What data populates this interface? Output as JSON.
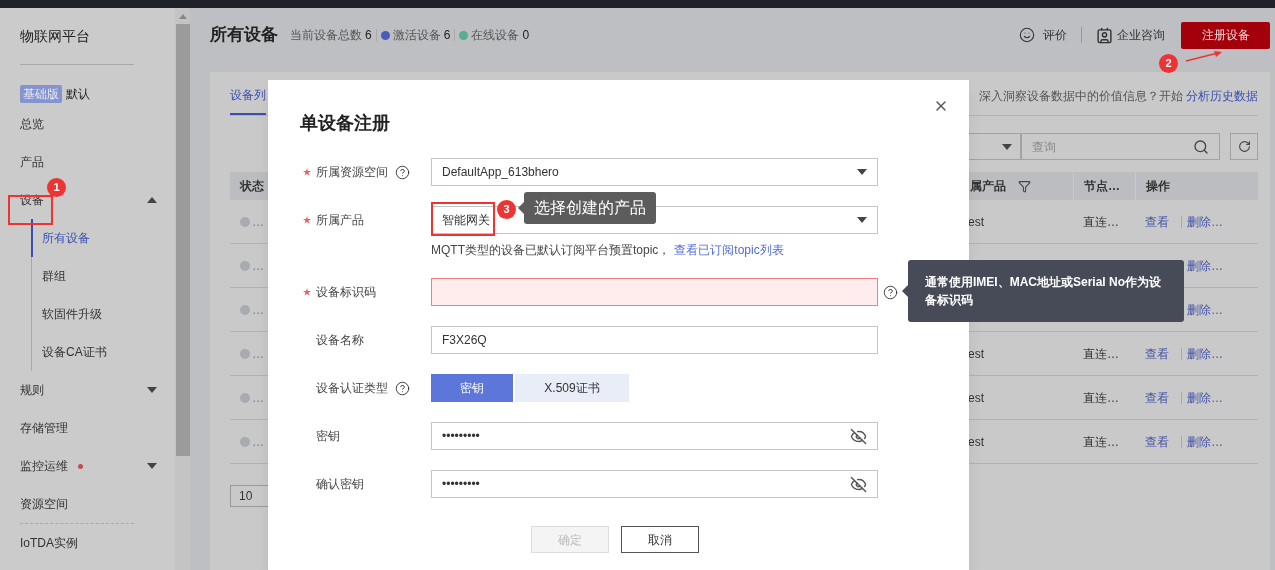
{
  "sidebar": {
    "title": "物联网平台",
    "edition_badge": "基础版",
    "edition_name": "默认",
    "items": [
      {
        "label": "总览",
        "kind": "link",
        "selected": false,
        "alert": false
      },
      {
        "label": "产品",
        "kind": "link",
        "selected": false,
        "alert": false
      },
      {
        "label": "设备",
        "kind": "group",
        "selected": false,
        "alert": false,
        "expanded": true,
        "children": [
          {
            "label": "所有设备",
            "selected": true
          },
          {
            "label": "群组",
            "selected": false
          },
          {
            "label": "软固件升级",
            "selected": false
          },
          {
            "label": "设备CA证书",
            "selected": false
          }
        ]
      },
      {
        "label": "规则",
        "kind": "group",
        "selected": false,
        "alert": false,
        "expanded": false
      },
      {
        "label": "存储管理",
        "kind": "link",
        "selected": false,
        "alert": false
      },
      {
        "label": "监控运维",
        "kind": "group",
        "selected": false,
        "alert": true,
        "expanded": false
      },
      {
        "label": "资源空间",
        "kind": "link",
        "selected": false,
        "alert": false
      },
      {
        "label": "IoTDA实例",
        "kind": "footer",
        "selected": false,
        "alert": false
      }
    ]
  },
  "header": {
    "title": "所有设备",
    "stats": [
      {
        "label": "当前设备总数",
        "value": "6"
      },
      {
        "label": "激活设备",
        "value": "6",
        "color": "#4b5cb8"
      },
      {
        "label": "在线设备",
        "value": "0",
        "color": "#55ae8d"
      }
    ],
    "actions": [
      "评价",
      "企业咨询"
    ],
    "primary_button": "注册设备"
  },
  "card": {
    "tab": "设备列",
    "promo_text": "深入洞察设备数据中的价值信息？开始",
    "promo_link": "分析历史数据",
    "search_placeholder": "查询",
    "columns": [
      "状态",
      "属产品",
      "节点…",
      "操作"
    ],
    "rows": [
      {
        "status": "…",
        "product": "est",
        "node": "直连…",
        "view": "查看",
        "delete": "删除…"
      },
      {
        "status": "…",
        "delete": "删除…"
      },
      {
        "status": "…",
        "delete": "删除…"
      },
      {
        "status": "…",
        "product": "est",
        "node": "直连…",
        "view": "查看",
        "delete": "删除…"
      },
      {
        "status": "…",
        "product": "est",
        "node": "直连…",
        "view": "查看",
        "delete": "删除…"
      },
      {
        "status": "…",
        "product": "est",
        "node": "直连…",
        "view": "查看",
        "delete": "删除…"
      }
    ],
    "page_size": "10"
  },
  "modal": {
    "title": "单设备注册",
    "fields": [
      {
        "label": "所属资源空间",
        "required": true,
        "label_help": true,
        "field_help": false,
        "kind": "select",
        "value": "DefaultApp_613bhero"
      },
      {
        "label": "所属产品",
        "required": true,
        "label_help": false,
        "field_help": false,
        "kind": "select",
        "value": "智能网关",
        "hint": "MQTT类型的设备已默认订阅平台预置topic，",
        "hint_link": "查看已订阅topic列表"
      },
      {
        "label": "设备标识码",
        "required": true,
        "label_help": false,
        "field_help": true,
        "kind": "input",
        "error": true
      },
      {
        "label": "设备名称",
        "required": false,
        "label_help": false,
        "field_help": false,
        "kind": "input",
        "value": "F3X26Q",
        "error": false
      },
      {
        "label": "设备认证类型",
        "required": false,
        "label_help": true,
        "field_help": false,
        "kind": "toggle",
        "options": [
          {
            "label": "密钥",
            "selected": true
          },
          {
            "label": "X.509证书",
            "selected": false
          }
        ]
      },
      {
        "label": "密钥",
        "required": false,
        "label_help": false,
        "field_help": false,
        "kind": "password",
        "value": "•••••••••"
      },
      {
        "label": "确认密钥",
        "required": false,
        "label_help": false,
        "field_help": false,
        "kind": "password",
        "value": "•••••••••"
      }
    ],
    "buttons": [
      {
        "label": "确定",
        "disabled": true
      },
      {
        "label": "取消",
        "disabled": false
      }
    ],
    "field_tooltip": "通常使用IMEI、MAC地址或Serial No作为设备标识码"
  },
  "annotations": [
    {
      "number": "1"
    },
    {
      "number": "2"
    },
    {
      "number": "3",
      "callout": "选择创建的产品"
    }
  ]
}
